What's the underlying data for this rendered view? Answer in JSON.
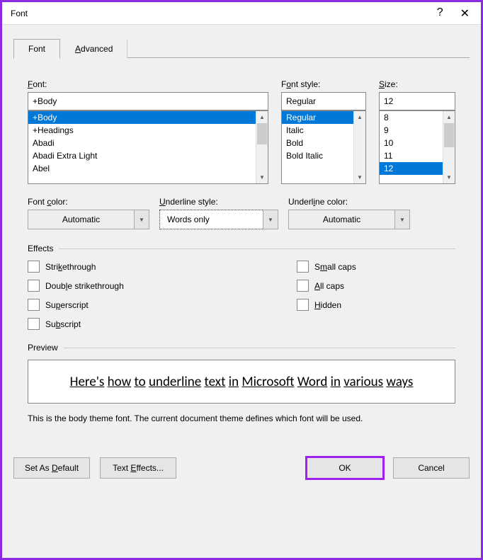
{
  "window": {
    "title": "Font",
    "help_symbol": "?",
    "close_symbol": "✕"
  },
  "tabs": {
    "font": "Font",
    "advanced": "Advanced"
  },
  "labels": {
    "font": "Font:",
    "font_style": "Font style:",
    "size": "Size:",
    "font_color": "Font color:",
    "underline_style": "Underline style:",
    "underline_color": "Underline color:",
    "effects": "Effects",
    "preview": "Preview"
  },
  "font": {
    "value": "+Body",
    "items": [
      "+Body",
      "+Headings",
      "Abadi",
      "Abadi Extra Light",
      "Abel"
    ]
  },
  "font_style": {
    "value": "Regular",
    "items": [
      "Regular",
      "Italic",
      "Bold",
      "Bold Italic"
    ]
  },
  "size": {
    "value": "12",
    "items": [
      "8",
      "9",
      "10",
      "11",
      "12"
    ]
  },
  "font_color": {
    "value": "Automatic"
  },
  "underline_style": {
    "value": "Words only"
  },
  "underline_color": {
    "value": "Automatic"
  },
  "effects": {
    "strikethrough": "Strikethrough",
    "double_strikethrough": "Double strikethrough",
    "superscript": "Superscript",
    "subscript": "Subscript",
    "small_caps": "Small caps",
    "all_caps": "All caps",
    "hidden": "Hidden"
  },
  "preview_words": [
    "Here's",
    "how",
    "to",
    "underline",
    "text",
    "in",
    "Microsoft",
    "Word",
    "in",
    "various",
    "ways"
  ],
  "hint": "This is the body theme font. The current document theme defines which font will be used.",
  "buttons": {
    "set_default": "Set As Default",
    "text_effects": "Text Effects...",
    "ok": "OK",
    "cancel": "Cancel"
  }
}
